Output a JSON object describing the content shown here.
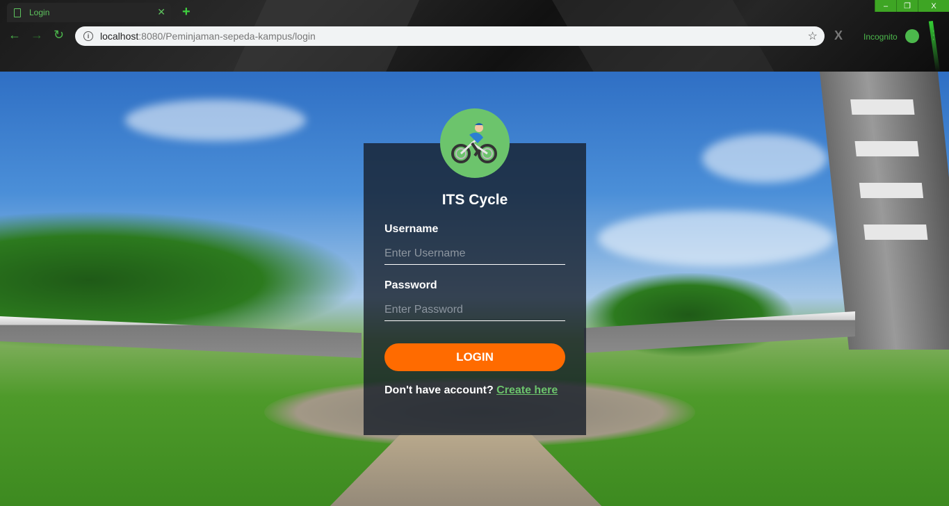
{
  "browser": {
    "tab_title": "Login",
    "tab_icon": "page-icon",
    "new_tab": "+",
    "url_host": "localhost",
    "url_path": ":8080/Peminjaman-sepeda-kampus/login",
    "incognito_label": "Incognito",
    "window_controls": {
      "minimize": "–",
      "restore": "❐",
      "close": "X"
    },
    "accent_color": "#4cb84c"
  },
  "login": {
    "title": "ITS Cycle",
    "logo": "cyclist-icon",
    "username_label": "Username",
    "username_placeholder": "Enter Username",
    "password_label": "Password",
    "password_placeholder": "Enter Password",
    "login_button": "LOGIN",
    "signup_prompt": "Don't have account?",
    "signup_link": "Create here",
    "button_color": "#ff6b00",
    "link_color": "#6cc46c"
  }
}
